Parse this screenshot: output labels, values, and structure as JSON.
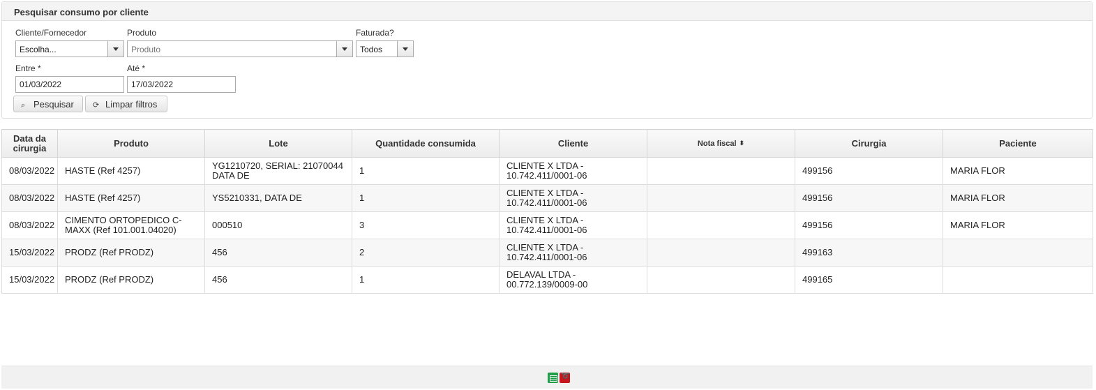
{
  "search": {
    "title": "Pesquisar consumo por cliente",
    "client_label": "Cliente/Fornecedor",
    "client_value": "Escolha...",
    "product_label": "Produto",
    "product_placeholder": "Produto",
    "invoiced_label": "Faturada?",
    "invoiced_value": "Todos",
    "from_label": "Entre *",
    "from_value": "01/03/2022",
    "to_label": "Até *",
    "to_value": "17/03/2022",
    "search_button": "Pesquisar",
    "clear_button": "Limpar filtros"
  },
  "table": {
    "headers": [
      "Data da cirurgia",
      "Produto",
      "Lote",
      "Quantidade consumida",
      "Cliente",
      "Nota fiscal",
      "Cirurgia",
      "Paciente"
    ],
    "rows": [
      [
        "08/03/2022",
        "HASTE (Ref 4257)",
        "YG1210720, SERIAL: 21070044 DATA DE",
        "1",
        "CLIENTE X LTDA - 10.742.411/0001-06",
        "",
        "499156",
        "MARIA FLOR"
      ],
      [
        "08/03/2022",
        "HASTE (Ref 4257)",
        "YS5210331, DATA DE",
        "1",
        "CLIENTE X LTDA - 10.742.411/0001-06",
        "",
        "499156",
        "MARIA FLOR"
      ],
      [
        "08/03/2022",
        "CIMENTO ORTOPEDICO C-MAXX (Ref 101.001.04020)",
        "000510",
        "3",
        "CLIENTE X LTDA - 10.742.411/0001-06",
        "",
        "499156",
        "MARIA FLOR"
      ],
      [
        "15/03/2022",
        "PRODZ (Ref PRODZ)",
        "456",
        "2",
        "CLIENTE X LTDA - 10.742.411/0001-06",
        "",
        "499163",
        ""
      ],
      [
        "15/03/2022",
        "PRODZ (Ref PRODZ)",
        "456",
        "1",
        "DELAVAL LTDA - 00.772.139/0009-00",
        "",
        "499165",
        ""
      ]
    ]
  },
  "footer": {
    "icons": [
      "excel-export-icon",
      "pdf-export-icon"
    ],
    "excel_color": "#1f9d48",
    "pdf_color": "#c8161d"
  }
}
